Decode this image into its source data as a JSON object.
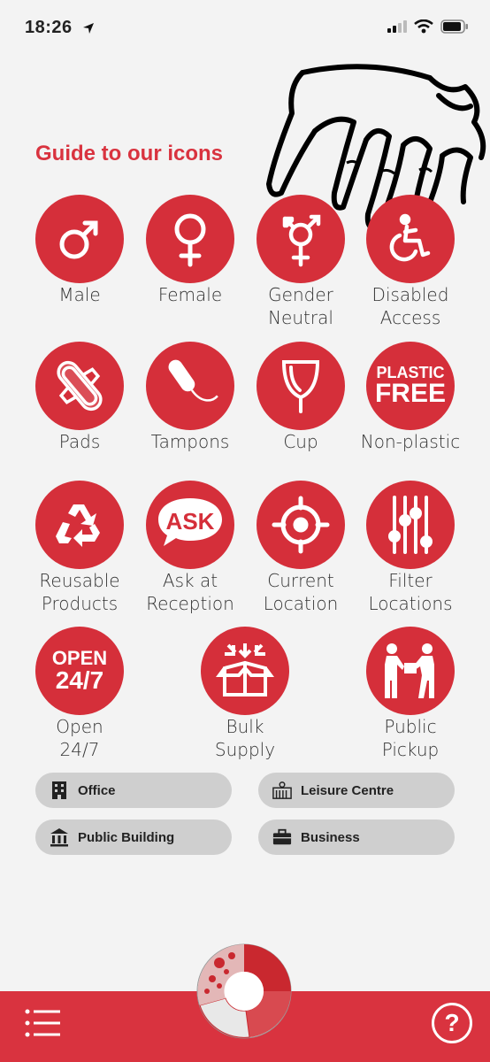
{
  "status": {
    "time": "18:26"
  },
  "title": "Guide to our icons",
  "icons": {
    "male": {
      "label1": "Male",
      "label2": ""
    },
    "female": {
      "label1": "Female",
      "label2": ""
    },
    "gender_neutral": {
      "label1": "Gender",
      "label2": "Neutral"
    },
    "disabled": {
      "label1": "Disabled",
      "label2": "Access"
    },
    "pads": {
      "label1": "Pads",
      "label2": ""
    },
    "tampons": {
      "label1": "Tampons",
      "label2": ""
    },
    "cup": {
      "label1": "Cup",
      "label2": ""
    },
    "non_plastic": {
      "label1": "Non-plastic",
      "label2": "",
      "badge1": "PLASTIC",
      "badge2": "FREE"
    },
    "reusable": {
      "label1": "Reusable",
      "label2": "Products"
    },
    "ask": {
      "label1": "Ask at",
      "label2": "Reception",
      "badge": "ASK"
    },
    "location": {
      "label1": "Current",
      "label2": "Location"
    },
    "filter": {
      "label1": "Filter",
      "label2": "Locations"
    },
    "open": {
      "label1": "Open",
      "label2": "24/7",
      "badge1": "OPEN",
      "badge2": "24/7"
    },
    "bulk": {
      "label1": "Bulk",
      "label2": "Supply"
    },
    "pickup": {
      "label1": "Public",
      "label2": "Pickup"
    }
  },
  "categories": {
    "office": "Office",
    "leisure": "Leisure Centre",
    "public_building": "Public Building",
    "business": "Business"
  },
  "colors": {
    "accent": "#d9333f",
    "icon_bg": "#d52f3a",
    "pill": "#cfcfcf"
  }
}
